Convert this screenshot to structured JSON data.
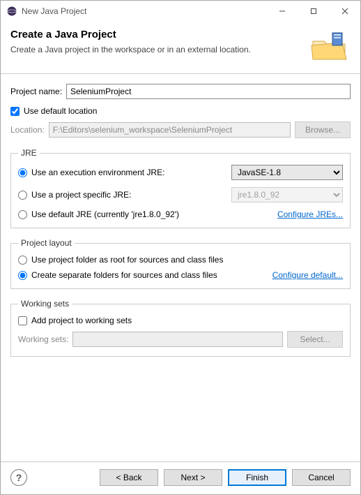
{
  "window": {
    "title": "New Java Project"
  },
  "header": {
    "title": "Create a Java Project",
    "subtitle": "Create a Java project in the workspace or in an external location."
  },
  "project": {
    "name_label": "Project name:",
    "name_value": "SeleniumProject",
    "use_default_label": "Use default location",
    "location_label": "Location:",
    "location_value": "F:\\Editors\\selenium_workspace\\SeleniumProject",
    "browse_label": "Browse..."
  },
  "jre": {
    "legend": "JRE",
    "opt_env": "Use an execution environment JRE:",
    "env_selected": "JavaSE-1.8",
    "opt_specific": "Use a project specific JRE:",
    "specific_selected": "jre1.8.0_92",
    "opt_default": "Use default JRE (currently 'jre1.8.0_92')",
    "configure": "Configure JREs..."
  },
  "layout": {
    "legend": "Project layout",
    "opt_root": "Use project folder as root for sources and class files",
    "opt_separate": "Create separate folders for sources and class files",
    "configure": "Configure default..."
  },
  "ws": {
    "legend": "Working sets",
    "add_label": "Add project to working sets",
    "ws_label": "Working sets:",
    "select_label": "Select..."
  },
  "footer": {
    "back": "< Back",
    "next": "Next >",
    "finish": "Finish",
    "cancel": "Cancel"
  }
}
